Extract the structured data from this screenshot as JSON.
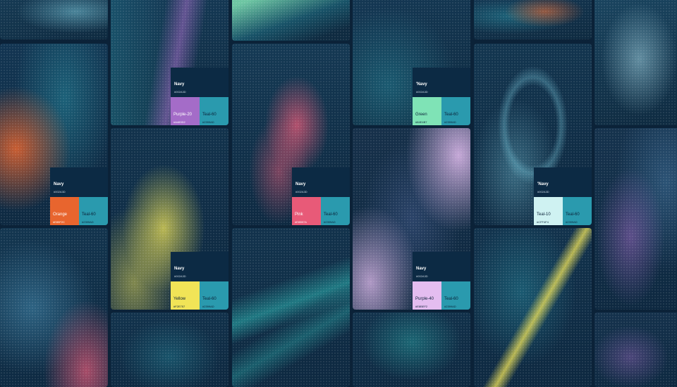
{
  "swatches": [
    {
      "top": {
        "name": "Navy",
        "hex": "#002A3D"
      },
      "left": {
        "name": "Purple-20",
        "hex": "#A483D2",
        "color": "#a46cc8",
        "text": "#ffffff"
      },
      "right": {
        "name": "Teal-60",
        "hex": "#2399AD",
        "color": "#2a9aae",
        "text": "#0b2238"
      }
    },
    {
      "top": {
        "name": "'Navy",
        "hex": "#002A3D"
      },
      "left": {
        "name": "Green",
        "hex": "#84E4B7",
        "color": "#7fe3b6",
        "text": "#0b2238"
      },
      "right": {
        "name": "Teal-60",
        "hex": "#2399AD",
        "color": "#2a9aae",
        "text": "#0b2238"
      }
    },
    {
      "top": {
        "name": "Navy",
        "hex": "#002A3D"
      },
      "left": {
        "name": "Orange",
        "hex": "#E85F2C",
        "color": "#e8652e",
        "text": "#ffffff"
      },
      "right": {
        "name": "Teal-60",
        "hex": "#2399AD",
        "color": "#2a9aae",
        "text": "#0b2238"
      }
    },
    {
      "top": {
        "name": "Navy",
        "hex": "#002A3D"
      },
      "left": {
        "name": "Pink",
        "hex": "#E85B7A",
        "color": "#e85a78",
        "text": "#ffffff"
      },
      "right": {
        "name": "Teal-60",
        "hex": "#2399AD",
        "color": "#2a9aae",
        "text": "#0b2238"
      }
    },
    {
      "top": {
        "name": "'Navy",
        "hex": "#002A3D"
      },
      "left": {
        "name": "Teal-10",
        "hex": "#CFF4F4",
        "color": "#cff2f2",
        "text": "#0b2238"
      },
      "right": {
        "name": "Teal-60",
        "hex": "#2399AD",
        "color": "#2a9aae",
        "text": "#0b2238"
      }
    },
    {
      "top": {
        "name": "Navy",
        "hex": "#002A3D"
      },
      "left": {
        "name": "Yellow",
        "hex": "#F2E757",
        "color": "#f1e457",
        "text": "#0b2238"
      },
      "right": {
        "name": "Teal-60",
        "hex": "#2399AD",
        "color": "#2a9aae",
        "text": "#0b2238"
      }
    },
    {
      "top": {
        "name": "Navy",
        "hex": "#002A3D"
      },
      "left": {
        "name": "Purple-40",
        "hex": "#E8BEF2",
        "color": "#e4bdf0",
        "text": "#0b2238"
      },
      "right": {
        "name": "Teal-60",
        "hex": "#2399AD",
        "color": "#2a9aae",
        "text": "#0b2238"
      }
    }
  ]
}
